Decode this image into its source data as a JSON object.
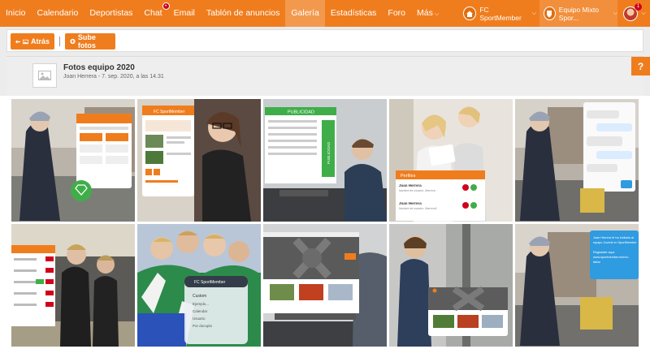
{
  "nav": {
    "items": [
      {
        "label": "Inicio"
      },
      {
        "label": "Calendario"
      },
      {
        "label": "Deportistas"
      },
      {
        "label": "Chat",
        "badge": "•"
      },
      {
        "label": "Email"
      },
      {
        "label": "Tablón de anuncios"
      },
      {
        "label": "Galería",
        "active": true
      },
      {
        "label": "Estadísticas"
      },
      {
        "label": "Foro"
      },
      {
        "label": "Más"
      }
    ],
    "club": "FC SportMember",
    "team": "Equipo Mixto Spor...",
    "user_badge": "1"
  },
  "toolbar": {
    "back_label": "Atrás",
    "upload_label": "Sube fotos"
  },
  "help_label": "?",
  "album": {
    "title": "Fotos equipo 2020",
    "meta": "Joan Herrera - 7. sep. 2020, a las 14.31"
  },
  "colors": {
    "brand": "#f07d1d",
    "badge": "#d0021b",
    "green": "#3fae49"
  },
  "photos": [
    {
      "id": "photo-1",
      "subject": "cyclist-phone-app"
    },
    {
      "id": "photo-2",
      "subject": "woman-glasses-phone-app"
    },
    {
      "id": "photo-3",
      "subject": "man-laptop-publicidad"
    },
    {
      "id": "photo-4",
      "subject": "two-women-tablet-perfiles"
    },
    {
      "id": "photo-5",
      "subject": "cyclist-phone-chat"
    },
    {
      "id": "photo-6",
      "subject": "boys-corridor-list"
    },
    {
      "id": "photo-7",
      "subject": "kids-football-huddle"
    },
    {
      "id": "photo-8",
      "subject": "laptop-website"
    },
    {
      "id": "photo-9",
      "subject": "man-station-tablet"
    },
    {
      "id": "photo-10",
      "subject": "cyclist-phone-message"
    }
  ],
  "photo_texts": {
    "p2_header": "FC SportMember",
    "p3_banner": "PUBLICIDAD",
    "p3_side": "PUBLICIDAD",
    "p4_title": "Perfiles",
    "p4_name1": "Joan Herrera",
    "p4_sub1": "Nombre de usuario: Jherrera",
    "p4_name2": "Joan Herrera",
    "p4_sub2": "Nombre de usuario: Jherrera2",
    "p7_header": "FC SportMember",
    "p7_item1": "Custom",
    "p7_item2": "Ejemplo...",
    "p7_item3": "Calendar",
    "p7_item4": "Usuario",
    "p7_item5": "Por docuplo",
    "p10_msg1": "Joan Herrera te ha invitado al equipo Juvenil en SportMember",
    "p10_msg2": "Regístrate aquí: www.sportmember.es/invitation"
  }
}
